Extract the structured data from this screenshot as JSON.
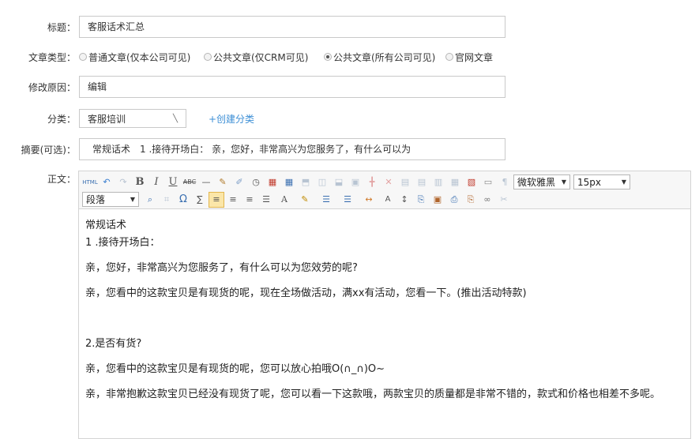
{
  "form": {
    "title": {
      "label": "标题：",
      "value": "客服话术汇总"
    },
    "article_type": {
      "label": "文章类型：",
      "options": [
        {
          "label": "普通文章(仅本公司可见)",
          "checked": false
        },
        {
          "label": "公共文章(仅CRM可见)",
          "checked": false
        },
        {
          "label": "公共文章(所有公司可见)",
          "checked": true
        },
        {
          "label": "官网文章",
          "checked": false
        }
      ]
    },
    "reason": {
      "label": "修改原因：",
      "value": "编辑"
    },
    "category": {
      "label": "分类：",
      "value": "客服培训",
      "create_link": "+创建分类"
    },
    "summary": {
      "label": "摘要(可选)：",
      "value": "常规话术　1 .接待开场白：  亲，您好，非常高兴为您服务了，有什么可以为"
    },
    "body": {
      "label": "正文："
    }
  },
  "editor": {
    "toolbar": {
      "font_family": "微软雅黑",
      "font_size": "15px",
      "paragraph": "段落",
      "html_label": "HTML",
      "bold": "B",
      "italic": "I",
      "underline": "U",
      "strike": "ABC",
      "special_char": "Ω",
      "font_color": "A",
      "indent_label": "A"
    },
    "content": {
      "heading": "常规话术",
      "s1_title": "1 .接待开场白：",
      "s1_p1": "亲，您好，非常高兴为您服务了，有什么可以为您效劳的呢?",
      "s1_p2": "亲，您看中的这款宝贝是有现货的呢，现在全场做活动，满xx有活动，您看一下。(推出活动特款)",
      "s2_title": "2.是否有货?",
      "s2_p1": "亲，您看中的这款宝贝是有现货的呢，您可以放心拍哦O(∩_∩)O~",
      "s2_p2": "亲，非常抱歉这款宝贝已经没有现货了呢，您可以看一下这款哦，两款宝贝的质量都是非常不错的，款式和价格也相差不多呢。"
    }
  }
}
